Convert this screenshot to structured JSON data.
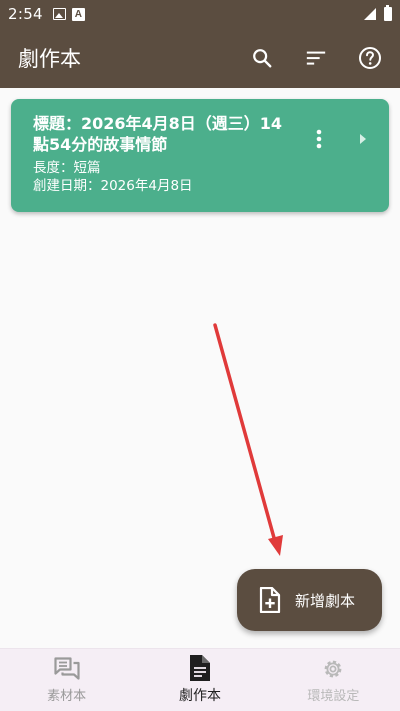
{
  "status_bar": {
    "time": "2:54",
    "icons": [
      "image-icon",
      "a-icon",
      "signal-icon",
      "battery-icon"
    ]
  },
  "app_bar": {
    "title": "劇作本",
    "actions": [
      "search-icon",
      "sort-icon",
      "help-icon"
    ]
  },
  "script_card": {
    "title": "標題：2026年4月8日（週三）14點54分的故事情節",
    "length": "長度：短篇",
    "created": "創建日期：2026年4月8日",
    "color": "#4caf8c"
  },
  "fab": {
    "label": "新增劇本",
    "icon": "new-file-icon"
  },
  "annotation": {
    "arrow_color": "#e03a3a"
  },
  "bottom_nav": {
    "items": [
      {
        "label": "素材本",
        "icon": "chat-icon"
      },
      {
        "label": "劇作本",
        "icon": "document-icon"
      },
      {
        "label": "環境設定",
        "icon": "gear-icon"
      }
    ],
    "active_index": 1
  },
  "colors": {
    "primary": "#5b4d40",
    "background": "#fafafa",
    "nav_background": "#f5eef5"
  }
}
